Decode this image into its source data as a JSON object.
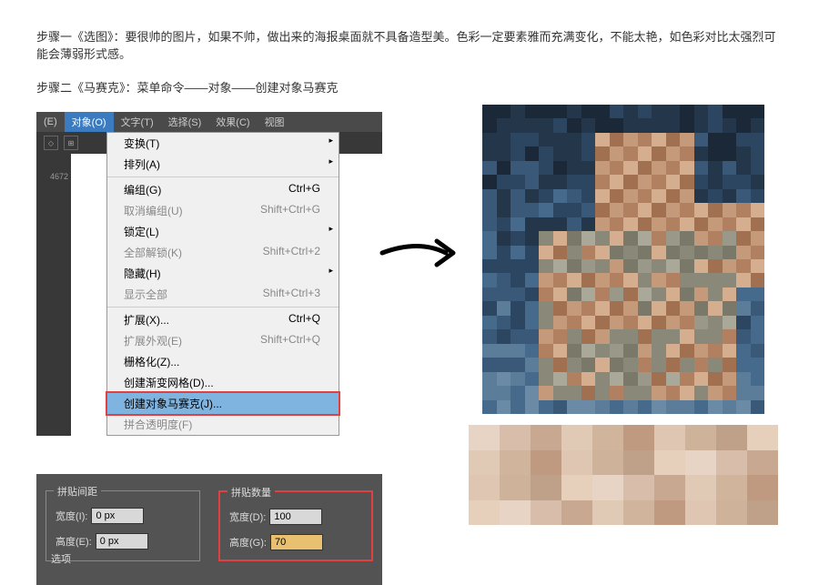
{
  "steps": {
    "step1": "步骤一《选图》：要很帅的图片，如果不帅，做出来的海报桌面就不具备造型美。色彩一定要素雅而充满变化，不能太艳，如色彩对比太强烈可能会薄弱形式感。",
    "step2": "步骤二《马赛克》：菜单命令——对象——创建对象马赛克"
  },
  "menubar": {
    "items": [
      {
        "label": "(E)"
      },
      {
        "label": "对象(O)"
      },
      {
        "label": "文字(T)"
      },
      {
        "label": "选择(S)"
      },
      {
        "label": "效果(C)"
      },
      {
        "label": "视图"
      }
    ],
    "activeIndex": 1
  },
  "sideNumber": "4672",
  "dropdown": {
    "items": [
      {
        "label": "变换(T)",
        "shortcut": "",
        "arrow": true
      },
      {
        "label": "排列(A)",
        "shortcut": "",
        "arrow": true
      },
      {
        "type": "sep"
      },
      {
        "label": "编组(G)",
        "shortcut": "Ctrl+G"
      },
      {
        "label": "取消编组(U)",
        "shortcut": "Shift+Ctrl+G",
        "disabled": true
      },
      {
        "label": "锁定(L)",
        "shortcut": "",
        "arrow": true
      },
      {
        "label": "全部解锁(K)",
        "shortcut": "Shift+Ctrl+2",
        "disabled": true
      },
      {
        "label": "隐藏(H)",
        "shortcut": "",
        "arrow": true
      },
      {
        "label": "显示全部",
        "shortcut": "Shift+Ctrl+3",
        "disabled": true
      },
      {
        "type": "sep"
      },
      {
        "label": "扩展(X)...",
        "shortcut": "Ctrl+Q"
      },
      {
        "label": "扩展外观(E)",
        "shortcut": "Shift+Ctrl+Q",
        "disabled": true
      },
      {
        "label": "栅格化(Z)...",
        "shortcut": ""
      },
      {
        "label": "创建渐变网格(D)...",
        "shortcut": ""
      },
      {
        "label": "创建对象马赛克(J)...",
        "shortcut": "",
        "highlighted": true
      },
      {
        "label": "拼合透明度(F)",
        "shortcut": "",
        "disabled": true
      }
    ]
  },
  "panel": {
    "spacing": {
      "title": "拼贴间距",
      "width": {
        "label": "宽度(I):",
        "value": "0 px"
      },
      "height": {
        "label": "高度(E):",
        "value": "0 px"
      }
    },
    "count": {
      "title": "拼贴数量",
      "width": {
        "label": "宽度(D):",
        "value": "100"
      },
      "height": {
        "label": "高度(G):",
        "value": "70"
      }
    },
    "options": "选项"
  }
}
